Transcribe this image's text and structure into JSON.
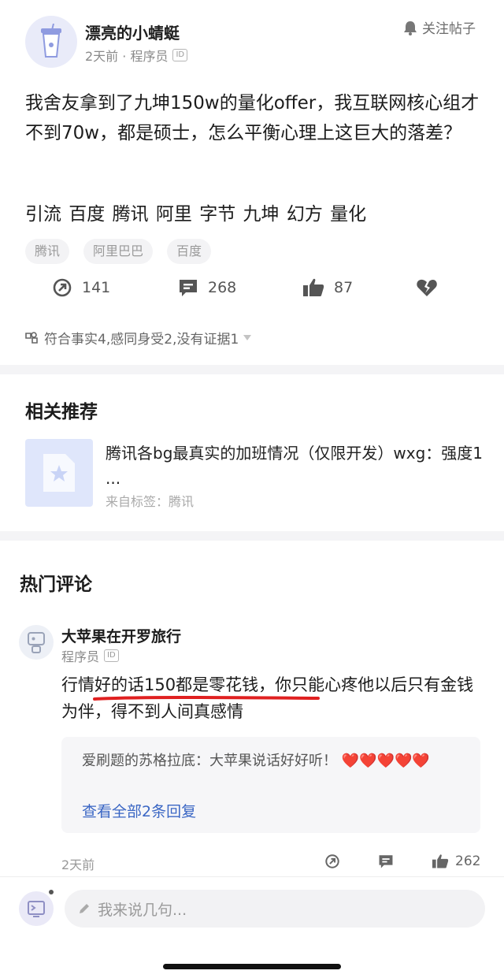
{
  "post": {
    "author_name": "漂亮的小蜻蜓",
    "author_meta": "2天前 · 程序员",
    "id_badge": "ID",
    "follow_label": "关注帖子",
    "body": "我舍友拿到了九坤150w的量化offer，我互联网核心组才不到70w，都是硕士，怎么平衡心理上这巨大的落差？",
    "keywords": "引流 百度 腾讯 阿里 字节 九坤 幻方 量化",
    "tags": [
      "腾讯",
      "阿里巴巴",
      "百度"
    ],
    "actions": {
      "share_count": "141",
      "comment_count": "268",
      "like_count": "87"
    },
    "reactions_summary": "符合事实4,感同身受2,没有证据1"
  },
  "related": {
    "title": "相关推荐",
    "item": {
      "title": "腾讯各bg最真实的加班情况（仅限开发）wxg：强度1 ...",
      "source": "来自标签：腾讯"
    }
  },
  "hot_comments": {
    "title": "热门评论",
    "comment": {
      "author_name": "大苹果在开罗旅行",
      "author_meta": "程序员",
      "id_badge": "ID",
      "text": "行情好的话150都是零花钱，你只能心疼他以后只有金钱为伴，得不到人间真感情",
      "reply": {
        "author": "爱刷题的苏格拉底：",
        "text": "大苹果说话好好听！",
        "hearts": "❤️❤️❤️❤️❤️",
        "view_all": "查看全部2条回复"
      },
      "time": "2天前",
      "like_count": "262"
    }
  },
  "composer": {
    "placeholder": "我来说几句..."
  },
  "colors": {
    "accent_link": "#3a66c4",
    "underline_red": "#e02020",
    "heart_red": "#e8323c"
  }
}
